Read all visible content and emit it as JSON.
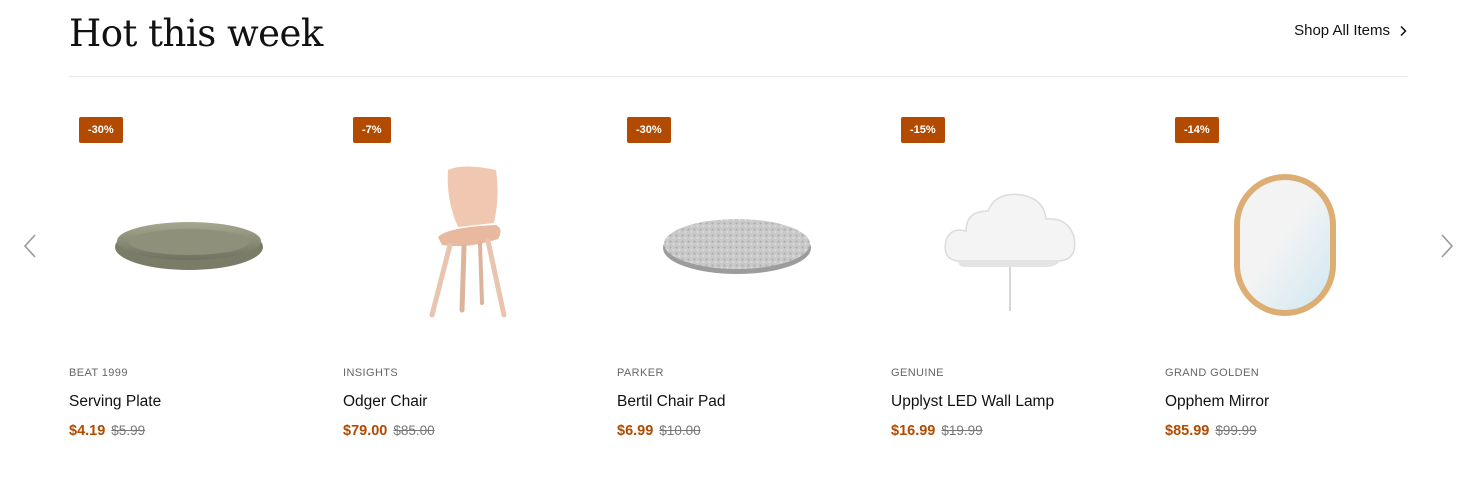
{
  "header": {
    "title": "Hot this week",
    "shop_all_label": "Shop All Items"
  },
  "colors": {
    "accent": "#b24b00",
    "text": "#111111",
    "muted": "#777777"
  },
  "products": [
    {
      "badge": "-30%",
      "brand": "BEAT 1999",
      "name": "Serving Plate",
      "price": "$4.19",
      "old_price": "$5.99",
      "image": "serving-plate"
    },
    {
      "badge": "-7%",
      "brand": "INSIGHTS",
      "name": "Odger Chair",
      "price": "$79.00",
      "old_price": "$85.00",
      "image": "chair"
    },
    {
      "badge": "-30%",
      "brand": "PARKER",
      "name": "Bertil Chair Pad",
      "price": "$6.99",
      "old_price": "$10.00",
      "image": "chair-pad"
    },
    {
      "badge": "-15%",
      "brand": "GENUINE",
      "name": "Upplyst LED Wall Lamp",
      "price": "$16.99",
      "old_price": "$19.99",
      "image": "cloud-lamp"
    },
    {
      "badge": "-14%",
      "brand": "GRAND GOLDEN",
      "name": "Opphem Mirror",
      "price": "$85.99",
      "old_price": "$99.99",
      "image": "mirror"
    }
  ],
  "navigation": {
    "prev_icon": "chevron-left-icon",
    "next_icon": "chevron-right-icon"
  }
}
